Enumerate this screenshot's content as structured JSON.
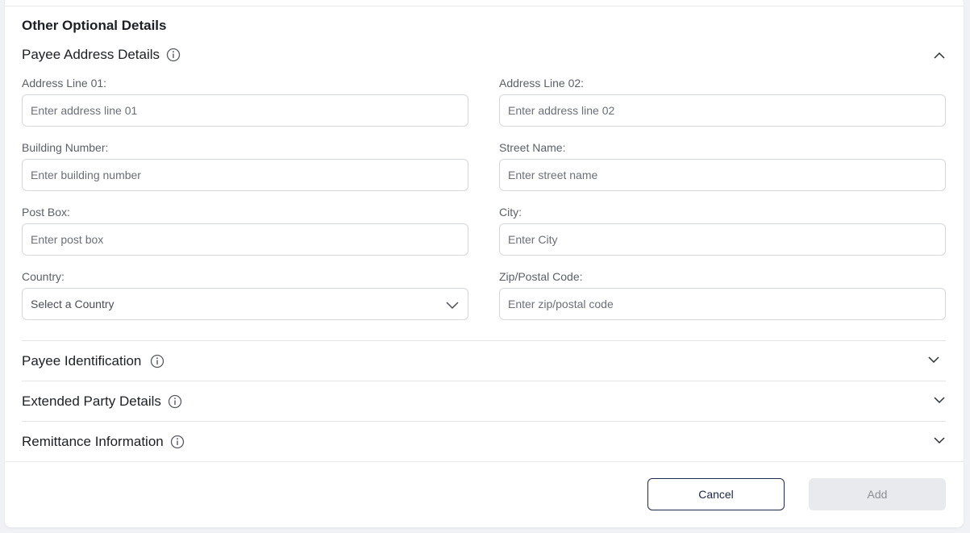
{
  "section_heading": "Other Optional Details",
  "accordions": {
    "payee_address": {
      "title": "Payee Address Details",
      "expanded": true
    },
    "payee_identification": {
      "title": "Payee Identification",
      "expanded": false
    },
    "extended_party": {
      "title": "Extended Party Details",
      "expanded": false
    },
    "remittance": {
      "title": "Remittance Information",
      "expanded": false
    }
  },
  "fields": {
    "address_line_1": {
      "label": "Address Line 01:",
      "placeholder": "Enter address line 01",
      "value": ""
    },
    "address_line_2": {
      "label": "Address Line 02:",
      "placeholder": "Enter address line 02",
      "value": ""
    },
    "building_number": {
      "label": "Building Number:",
      "placeholder": "Enter building number",
      "value": ""
    },
    "street_name": {
      "label": "Street Name:",
      "placeholder": "Enter street name",
      "value": ""
    },
    "post_box": {
      "label": "Post Box:",
      "placeholder": "Enter post box",
      "value": ""
    },
    "city": {
      "label": "City:",
      "placeholder": "Enter City",
      "value": ""
    },
    "country": {
      "label": "Country:",
      "selected": "Select a Country"
    },
    "zip": {
      "label": "Zip/Postal Code:",
      "placeholder": "Enter zip/postal code",
      "value": ""
    }
  },
  "buttons": {
    "cancel": "Cancel",
    "add": "Add"
  },
  "icons": {
    "info": "info-circle-icon",
    "expand": "chevron-down-icon",
    "collapse": "chevron-up-icon"
  },
  "colors": {
    "border": "#d4d7dc",
    "cancel_border": "#1e2a4a",
    "add_disabled_bg": "#e9eaee",
    "add_disabled_text": "#8a8e96"
  }
}
